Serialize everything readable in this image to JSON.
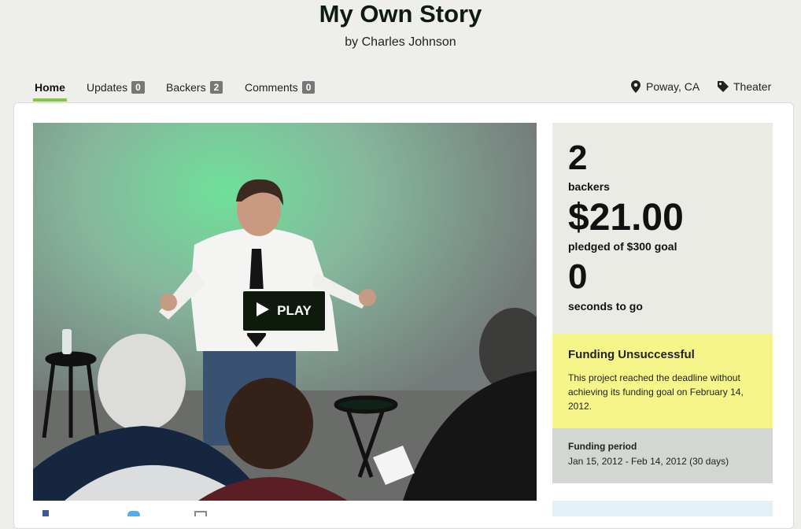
{
  "project": {
    "title": "My Own Story",
    "byline": "by Charles Johnson"
  },
  "nav": {
    "tabs": [
      {
        "label": "Home",
        "active": true
      },
      {
        "label": "Updates",
        "count": "0"
      },
      {
        "label": "Backers",
        "count": "2"
      },
      {
        "label": "Comments",
        "count": "0"
      }
    ],
    "location": "Poway, CA",
    "category": "Theater"
  },
  "video": {
    "play_label": "PLAY"
  },
  "stats": {
    "backers_count": "2",
    "backers_label": "backers",
    "pledged_amount": "$21.00",
    "pledged_label": "pledged of $300 goal",
    "time_left": "0",
    "time_label": "seconds to go"
  },
  "status": {
    "heading": "Funding Unsuccessful",
    "message": "This project reached the deadline without achieving its funding goal on February 14, 2012."
  },
  "funding_period": {
    "label": "Funding period",
    "value": "Jan 15, 2012 - Feb 14, 2012 (30 days)"
  },
  "colors": {
    "accent": "#86c540",
    "play_button": "#0d1a0c",
    "status_box": "#f5f58a",
    "period_box": "#d3d7d1"
  }
}
